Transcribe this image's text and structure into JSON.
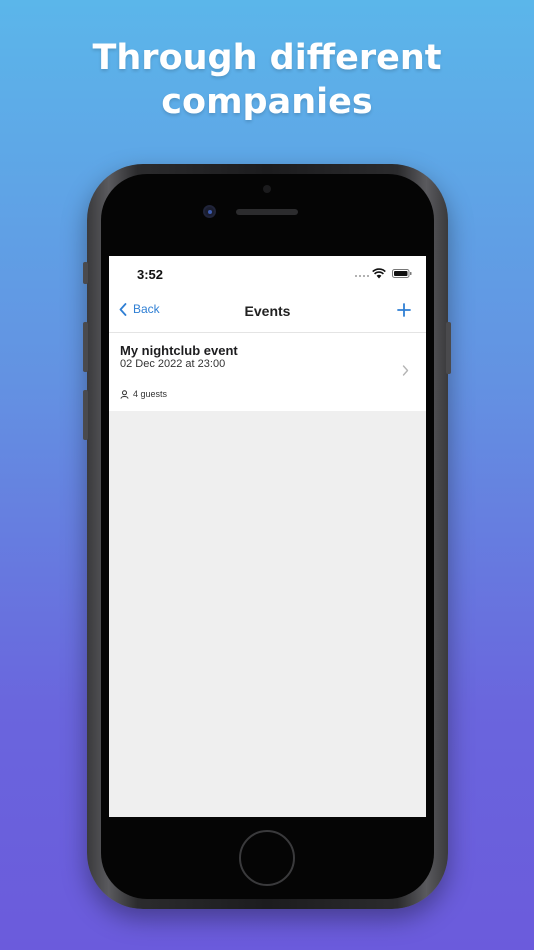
{
  "headline": {
    "line1": "Through different",
    "line2": "companies"
  },
  "status_bar": {
    "time": "3:52"
  },
  "nav": {
    "back_label": "Back",
    "title": "Events",
    "add_icon": "plus-icon"
  },
  "events": [
    {
      "name": "My nightclub event",
      "date": "02 Dec 2022 at 23:00",
      "guests": "4 guests"
    }
  ],
  "colors": {
    "accent": "#2f7fd4",
    "background_top": "#5bb6ea",
    "background_bottom": "#6b5bdc",
    "list_background": "#efefef"
  }
}
